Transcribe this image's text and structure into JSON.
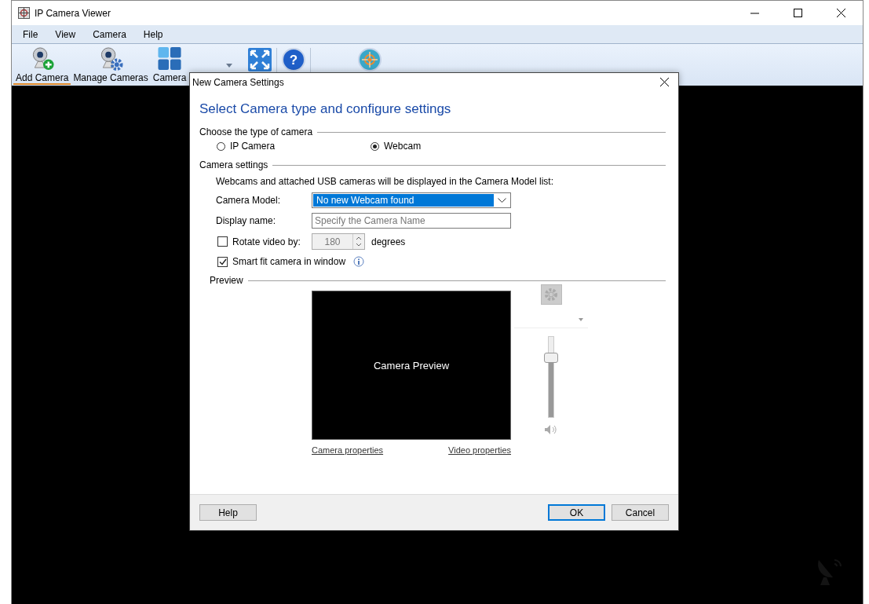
{
  "window": {
    "title": "IP Camera Viewer"
  },
  "menu": [
    "File",
    "View",
    "Camera",
    "Help"
  ],
  "toolbar": [
    {
      "kind": "add",
      "label": "Add Camera",
      "selected": true
    },
    {
      "kind": "manage",
      "label": "Manage Cameras",
      "selected": false
    },
    {
      "kind": "layout",
      "label": "Camera",
      "selected": false
    },
    {
      "kind": "dropdown"
    },
    {
      "kind": "fullscreen"
    },
    {
      "kind": "separator"
    },
    {
      "kind": "help",
      "glyph": "?"
    },
    {
      "kind": "separator"
    },
    {
      "kind": "target"
    }
  ],
  "dialog": {
    "title": "New Camera Settings",
    "heading": "Select Camera type and configure settings",
    "camera_type": {
      "label": "Choose the type of camera",
      "options": [
        {
          "label": "IP Camera",
          "selected": false
        },
        {
          "label": "Webcam",
          "selected": true
        }
      ]
    },
    "settings": {
      "label": "Camera settings",
      "note": "Webcams and attached USB cameras will be displayed in the Camera Model list:",
      "camera_model": {
        "label": "Camera Model:",
        "value": "No new Webcam found"
      },
      "display_name": {
        "label": "Display name:",
        "placeholder": "Specify the Camera Name"
      },
      "rotate": {
        "label": "Rotate video by:",
        "checked": false,
        "value": "180",
        "unit": "degrees"
      },
      "smart_fit": {
        "label": "Smart fit camera in window",
        "checked": true
      }
    },
    "preview": {
      "label": "Preview",
      "screen_text": "Camera Preview",
      "volume": {
        "level": 0.73
      },
      "links": [
        "Camera properties",
        "Video properties"
      ]
    },
    "buttons": [
      {
        "label": "Help",
        "default": false
      },
      {
        "label": "OK",
        "default": true
      },
      {
        "label": "Cancel",
        "default": false
      }
    ]
  }
}
